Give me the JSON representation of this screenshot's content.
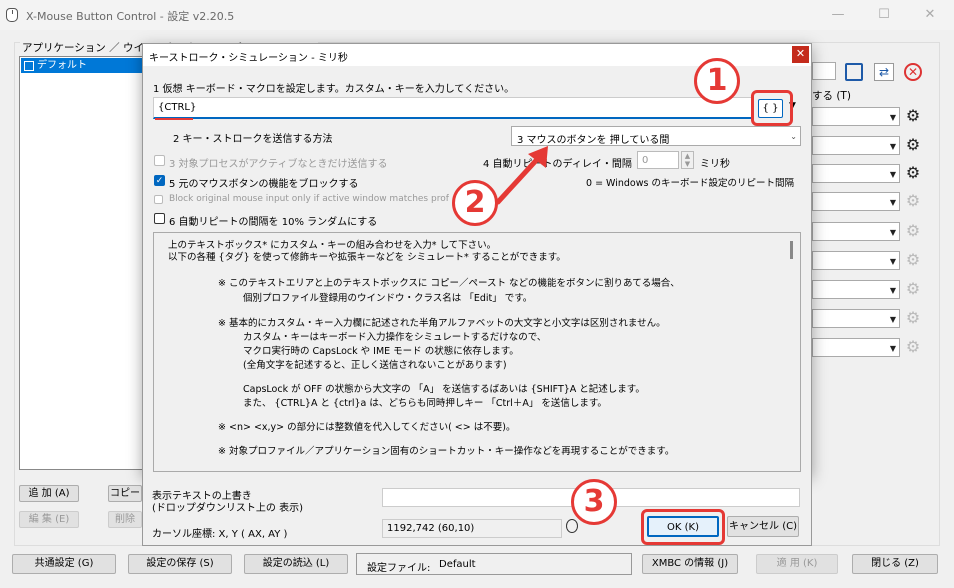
{
  "window": {
    "title": "X-Mouse Button Control - 設定    v2.20.5"
  },
  "main": {
    "apps_label": "アプリケーション ／ ウインドウ・クラス のプロファイル (%)",
    "profile_default": "デフォルト",
    "add_button": "追 加  (A)",
    "copy_button": "コピー",
    "edit_button": "編 集  (E)",
    "delete_button": "削除",
    "right_label": "する  (T)"
  },
  "dialog": {
    "title": "キーストローク・シミュレーション - ミリ秒",
    "step1_label": "1  仮想 キーボード・マクロを設定します。カスタム・キーを入力してください。",
    "keys_value": "{CTRL}",
    "tag_button": "{ }",
    "step2_label": "2  キー・ストロークを送信する方法",
    "method_value": "3  マウスのボタンを 押している間",
    "opt3_label": "3  対象プロセスがアクティブなときだけ送信する",
    "opt4_label": "4  自動リピートのディレイ・間隔",
    "opt4_value": "0",
    "opt4_unit": "ミリ秒",
    "opt4_note": "0 = Windows のキーボード設定のリピート間隔",
    "opt5_label": "5  元のマウスボタンの機能をブロックする",
    "opt_block_label": "Block original mouse input only if active window matches profile",
    "opt6_label": "6  自動リピートの間隔を 10% ランダムにする",
    "help_lines": [
      "上のテキストボックス* にカスタム・キーの組み合わせを入力* して下さい。",
      "以下の各種 {タグ} を使って修飾キーや拡張キーなどを シミュレート* することができます。",
      "※    このテキストエリアと上のテキストボックスに  コピー／ペースト  などの機能をボタンに割りあてる場合、",
      "個別プロファイル登録用のウインドウ・クラス名は 「Edit」 です。",
      "※    基本的にカスタム・キー入力欄に記述された半角アルファベットの大文字と小文字は区別されません。",
      "カスタム・キーはキーボード入力操作をシミュレートするだけなので、",
      "マクロ実行時の CapsLock や IME モード の状態に依存します。",
      "(全角文字を記述すると、正しく送信されないことがあります)",
      "CapsLock が OFF の状態から大文字の 「A」 を送信するばあいは  {SHIFT}A  と記述します。",
      "また、 {CTRL}A  と   {ctrl}a  は、どちらも同時押しキー 「Ctrl＋A」 を送信します。",
      "※    <n> <x,y> の部分には整数値を代入してください( <> は不要)。",
      "※    対象プロファイル／アプリケーション固有のショートカット・キー操作などを再現することができます。"
    ],
    "display_text_label_1": "表示テキストの上書き",
    "display_text_label_2": "(ドロップダウンリスト上の 表示)",
    "cursor_label": "カーソル座標:  X, Y  ( AX, AY )",
    "cursor_value": "1192,742 (60,10)",
    "ok_button": "OK  (K)",
    "cancel_button": "キャンセル (C)"
  },
  "bottom": {
    "common_settings": "共通設定 (G)",
    "save_settings": "設定の保存 (S)",
    "load_settings": "設定の読込 (L)",
    "settings_file_label": "設定ファイル:",
    "settings_file_value": "Default",
    "xmbc_info": "XMBC の情報 (J)",
    "apply": "適 用  (K)",
    "close": "閉じる (Z)"
  },
  "annotations": {
    "step1": "1",
    "step2": "2",
    "step3": "3"
  },
  "colors": {
    "annotation_red": "#e53935",
    "accent": "#0078d7"
  }
}
